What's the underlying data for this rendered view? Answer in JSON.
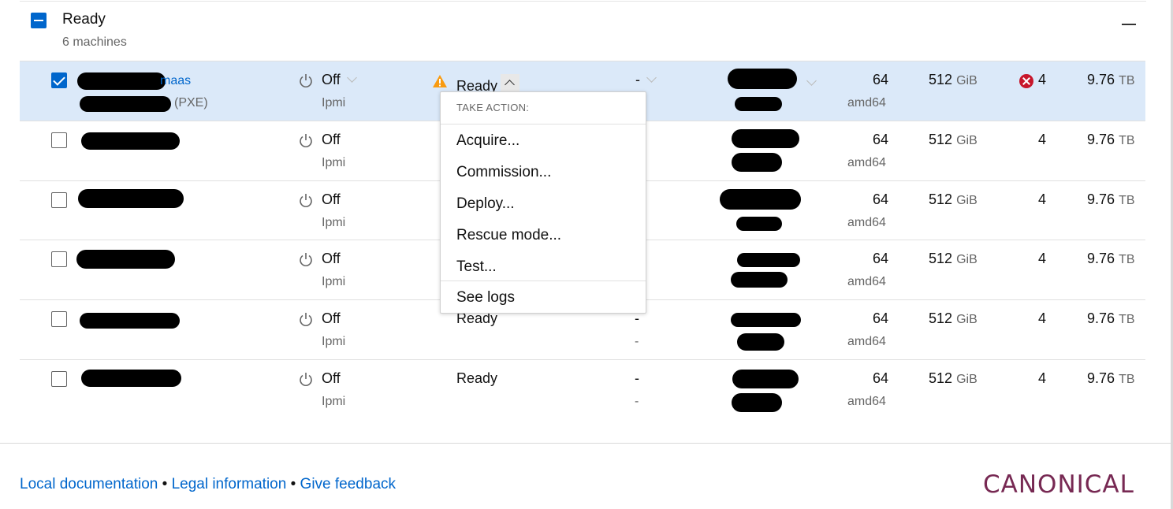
{
  "group": {
    "title": "Ready",
    "count_label": "6 machines"
  },
  "rows": [
    {
      "name_suffix": "maas",
      "boot_label": "(PXE)",
      "power": "Off",
      "power_type": "Ipmi",
      "status": "Ready",
      "status_sub": "",
      "zone": "-",
      "zone_sub": "",
      "cores": "64",
      "arch": "amd64",
      "ram": "512",
      "ram_unit": "GiB",
      "disks": "4",
      "storage": "9.76",
      "storage_unit": "TB",
      "selected": true
    },
    {
      "power": "Off",
      "power_type": "Ipmi",
      "cores": "64",
      "arch": "amd64",
      "ram": "512",
      "ram_unit": "GiB",
      "disks": "4",
      "storage": "9.76",
      "storage_unit": "TB"
    },
    {
      "power": "Off",
      "power_type": "Ipmi",
      "cores": "64",
      "arch": "amd64",
      "ram": "512",
      "ram_unit": "GiB",
      "disks": "4",
      "storage": "9.76",
      "storage_unit": "TB"
    },
    {
      "power": "Off",
      "power_type": "Ipmi",
      "cores": "64",
      "arch": "amd64",
      "ram": "512",
      "ram_unit": "GiB",
      "disks": "4",
      "storage": "9.76",
      "storage_unit": "TB"
    },
    {
      "power": "Off",
      "power_type": "Ipmi",
      "status": "Ready",
      "zone": "-",
      "zone_sub": "-",
      "cores": "64",
      "arch": "amd64",
      "ram": "512",
      "ram_unit": "GiB",
      "disks": "4",
      "storage": "9.76",
      "storage_unit": "TB"
    },
    {
      "power": "Off",
      "power_type": "Ipmi",
      "status": "Ready",
      "zone": "-",
      "zone_sub": "-",
      "cores": "64",
      "arch": "amd64",
      "ram": "512",
      "ram_unit": "GiB",
      "disks": "4",
      "storage": "9.76",
      "storage_unit": "TB"
    }
  ],
  "menu": {
    "header": "TAKE ACTION:",
    "items": [
      "Acquire...",
      "Commission...",
      "Deploy...",
      "Rescue mode...",
      "Test..."
    ],
    "see_logs": "See logs"
  },
  "footer": {
    "doc_link": "Local documentation",
    "legal_link": "Legal information",
    "feedback_link": "Give feedback",
    "separator": "•",
    "brand": "CANONICAL"
  },
  "colors": {
    "accent": "#0066cc",
    "selected_row": "#dbe9f9",
    "brand": "#772953",
    "warning": "#f99b11",
    "error": "#c7162b"
  }
}
